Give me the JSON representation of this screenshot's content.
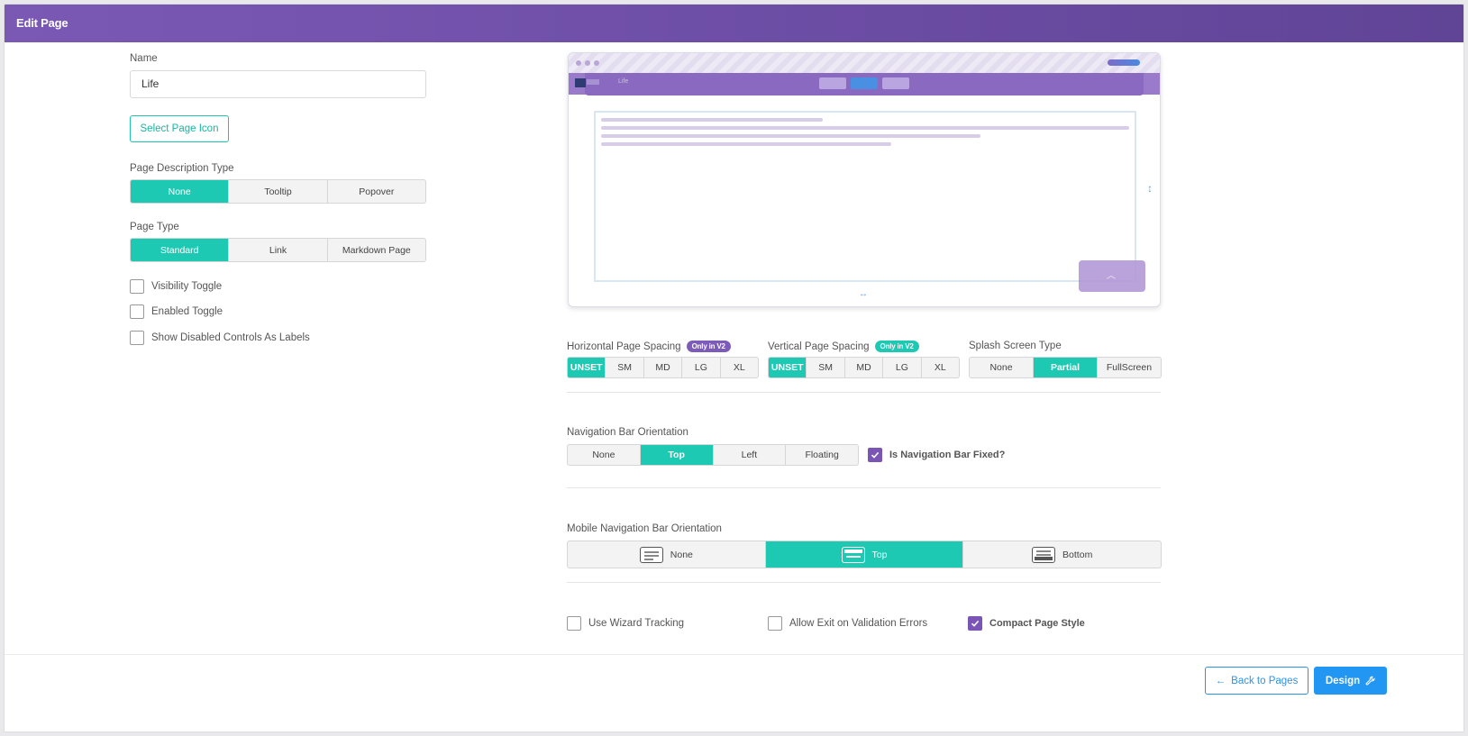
{
  "header": {
    "title": "Edit Page"
  },
  "name_field": {
    "label": "Name",
    "value": "Life"
  },
  "select_icon_button": "Select Page Icon",
  "description_type": {
    "label": "Page Description Type",
    "options": [
      "None",
      "Tooltip",
      "Popover"
    ],
    "selected": "None"
  },
  "page_type": {
    "label": "Page Type",
    "options": [
      "Standard",
      "Link",
      "Markdown Page"
    ],
    "selected": "Standard"
  },
  "left_checkboxes": [
    {
      "label": "Visibility Toggle",
      "checked": false
    },
    {
      "label": "Enabled Toggle",
      "checked": false
    },
    {
      "label": "Show Disabled Controls As Labels",
      "checked": false
    }
  ],
  "preview": {
    "page_title": "Life"
  },
  "horizontal_spacing": {
    "label": "Horizontal Page Spacing",
    "badge": "Only in V2",
    "options": [
      "UNSET",
      "SM",
      "MD",
      "LG",
      "XL"
    ],
    "selected": "UNSET"
  },
  "vertical_spacing": {
    "label": "Vertical Page Spacing",
    "badge": "Only in V2",
    "options": [
      "UNSET",
      "SM",
      "MD",
      "LG",
      "XL"
    ],
    "selected": "UNSET"
  },
  "splash_type": {
    "label": "Splash Screen Type",
    "options": [
      "None",
      "Partial",
      "FullScreen"
    ],
    "selected": "Partial"
  },
  "nav_orientation": {
    "label": "Navigation Bar Orientation",
    "options": [
      "None",
      "Top",
      "Left",
      "Floating"
    ],
    "selected": "Top",
    "fixed_label": "Is Navigation Bar Fixed?",
    "fixed_checked": true
  },
  "mobile_nav": {
    "label": "Mobile Navigation Bar Orientation",
    "options": [
      "None",
      "Top",
      "Bottom"
    ],
    "selected": "Top"
  },
  "bottom_checkboxes": [
    {
      "label": "Use Wizard Tracking",
      "checked": false
    },
    {
      "label": "Allow Exit on Validation Errors",
      "checked": false
    },
    {
      "label": "Compact Page Style",
      "checked": true
    }
  ],
  "footer": {
    "back_label": "Back to Pages",
    "design_label": "Design"
  },
  "colors": {
    "header": "#7a59b5",
    "accent_teal": "#1ec9b4",
    "primary_blue": "#2196f3",
    "check_purple": "#7b55b5"
  }
}
